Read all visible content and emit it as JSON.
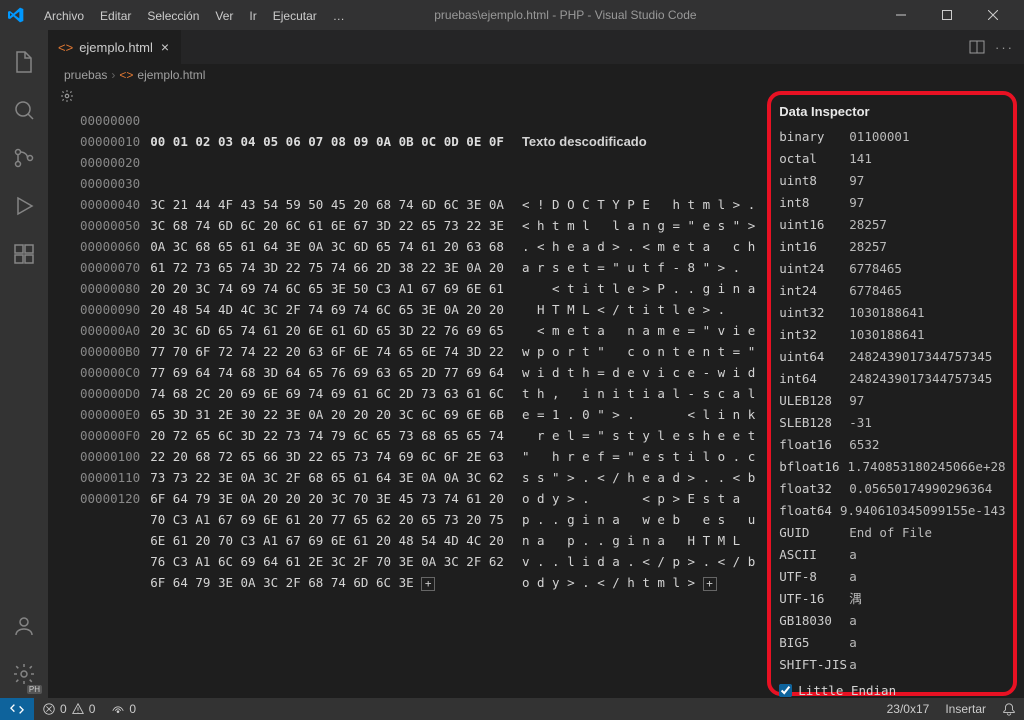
{
  "menu": [
    "Archivo",
    "Editar",
    "Selección",
    "Ver",
    "Ir",
    "Ejecutar",
    "…"
  ],
  "window_title": "pruebas\\ejemplo.html - PHP - Visual Studio Code",
  "tab": {
    "label": "ejemplo.html"
  },
  "breadcrumb": {
    "a": "pruebas",
    "b": "ejemplo.html"
  },
  "hex_header": "00 01 02 03 04 05 06 07 08 09 0A 0B 0C 0D 0E 0F",
  "decoded_header": "Texto descodificado",
  "offsets": [
    "00000000",
    "00000010",
    "00000020",
    "00000030",
    "00000040",
    "00000050",
    "00000060",
    "00000070",
    "00000080",
    "00000090",
    "000000A0",
    "000000B0",
    "000000C0",
    "000000D0",
    "000000E0",
    "000000F0",
    "00000100",
    "00000110",
    "00000120"
  ],
  "bytes_pre": [
    "3C 21 44 4F 43 54 59 50 45 20 68 74 6D 6C 3E 0A",
    "3C 68 74 6D 6C 20 6C "
  ],
  "bytes_sel": "61",
  "bytes_post_row1": " 6E 67 3D 22 65 73 22 3E",
  "bytes_rest": [
    "0A 3C 68 65 61 64 3E 0A 3C 6D 65 74 61 20 63 68",
    "61 72 73 65 74 3D 22 75 74 66 2D 38 22 3E 0A 20",
    "20 20 3C 74 69 74 6C 65 3E 50 C3 A1 67 69 6E 61",
    "20 48 54 4D 4C 3C 2F 74 69 74 6C 65 3E 0A 20 20",
    "20 3C 6D 65 74 61 20 6E 61 6D 65 3D 22 76 69 65",
    "77 70 6F 72 74 22 20 63 6F 6E 74 65 6E 74 3D 22",
    "77 69 64 74 68 3D 64 65 76 69 63 65 2D 77 69 64",
    "74 68 2C 20 69 6E 69 74 69 61 6C 2D 73 63 61 6C",
    "65 3D 31 2E 30 22 3E 0A 20 20 20 3C 6C 69 6E 6B",
    "20 72 65 6C 3D 22 73 74 79 6C 65 73 68 65 65 74",
    "22 20 68 72 65 66 3D 22 65 73 74 69 6C 6F 2E 63",
    "73 73 22 3E 0A 3C 2F 68 65 61 64 3E 0A 0A 3C 62",
    "6F 64 79 3E 0A 20 20 20 3C 70 3E 45 73 74 61 20",
    "70 C3 A1 67 69 6E 61 20 77 65 62 20 65 73 20 75",
    "6E 61 20 70 C3 A1 67 69 6E 61 20 48 54 4D 4C 20",
    "76 C3 A1 6C 69 64 61 2E 3C 2F 70 3E 0A 3C 2F 62",
    "6F 64 79 3E 0A 3C 2F 68 74 6D 6C 3E "
  ],
  "decoded_pre": "< ! D O C T Y P E   h t m l > .",
  "decoded_row1_pre": "< h t m l   l ",
  "decoded_sel": "a",
  "decoded_row1_post": " n g = \" e s \" >",
  "decoded_rest": [
    ". < h e a d > . < m e t a   c h",
    "a r s e t = \" u t f - 8 \" > .  ",
    "    < t i t l e > P . . g i n a",
    "  H T M L < / t i t l e > .    ",
    "  < m e t a   n a m e = \" v i e",
    "w p o r t \"   c o n t e n t = \"",
    "w i d t h = d e v i c e - w i d",
    "t h ,   i n i t i a l - s c a l",
    "e = 1 . 0 \" > .       < l i n k",
    "  r e l = \" s t y l e s h e e t",
    "\"   h r e f = \" e s t i l o . c",
    "s s \" > . < / h e a d > . . < b",
    "o d y > .       < p > E s t a  ",
    "p . . g i n a   w e b   e s   u",
    "n a   p . . g i n a   H T M L  ",
    "v . . l i d a . < / p > . < / b",
    "o d y > . < / h t m l > "
  ],
  "inspector": {
    "title": "Data Inspector",
    "rows": [
      {
        "k": "binary",
        "v": "01100001"
      },
      {
        "k": "octal",
        "v": "141"
      },
      {
        "k": "uint8",
        "v": "97"
      },
      {
        "k": "int8",
        "v": "97"
      },
      {
        "k": "uint16",
        "v": "28257"
      },
      {
        "k": "int16",
        "v": "28257"
      },
      {
        "k": "uint24",
        "v": "6778465"
      },
      {
        "k": "int24",
        "v": "6778465"
      },
      {
        "k": "uint32",
        "v": "1030188641"
      },
      {
        "k": "int32",
        "v": "1030188641"
      },
      {
        "k": "uint64",
        "v": "2482439017344757345"
      },
      {
        "k": "int64",
        "v": "2482439017344757345"
      },
      {
        "k": "ULEB128",
        "v": "97"
      },
      {
        "k": "SLEB128",
        "v": "-31"
      },
      {
        "k": "float16",
        "v": "6532"
      },
      {
        "k": "bfloat16",
        "v": "1.740853180245066e+28"
      },
      {
        "k": "float32",
        "v": "0.05650174990296364"
      },
      {
        "k": "float64",
        "v": "9.940610345099155e-143"
      },
      {
        "k": "GUID",
        "v": "End of File"
      },
      {
        "k": "ASCII",
        "v": "a"
      },
      {
        "k": "UTF-8",
        "v": "a"
      },
      {
        "k": "UTF-16",
        "v": "湡"
      },
      {
        "k": "GB18030",
        "v": "a"
      },
      {
        "k": "BIG5",
        "v": "a"
      },
      {
        "k": "SHIFT-JIS",
        "v": "a"
      }
    ],
    "endian_label": "Little Endian",
    "endian_checked": true
  },
  "status": {
    "errors": "0",
    "warnings": "0",
    "ports": "0",
    "pos": "23/0x17",
    "ins": "Insertar"
  }
}
